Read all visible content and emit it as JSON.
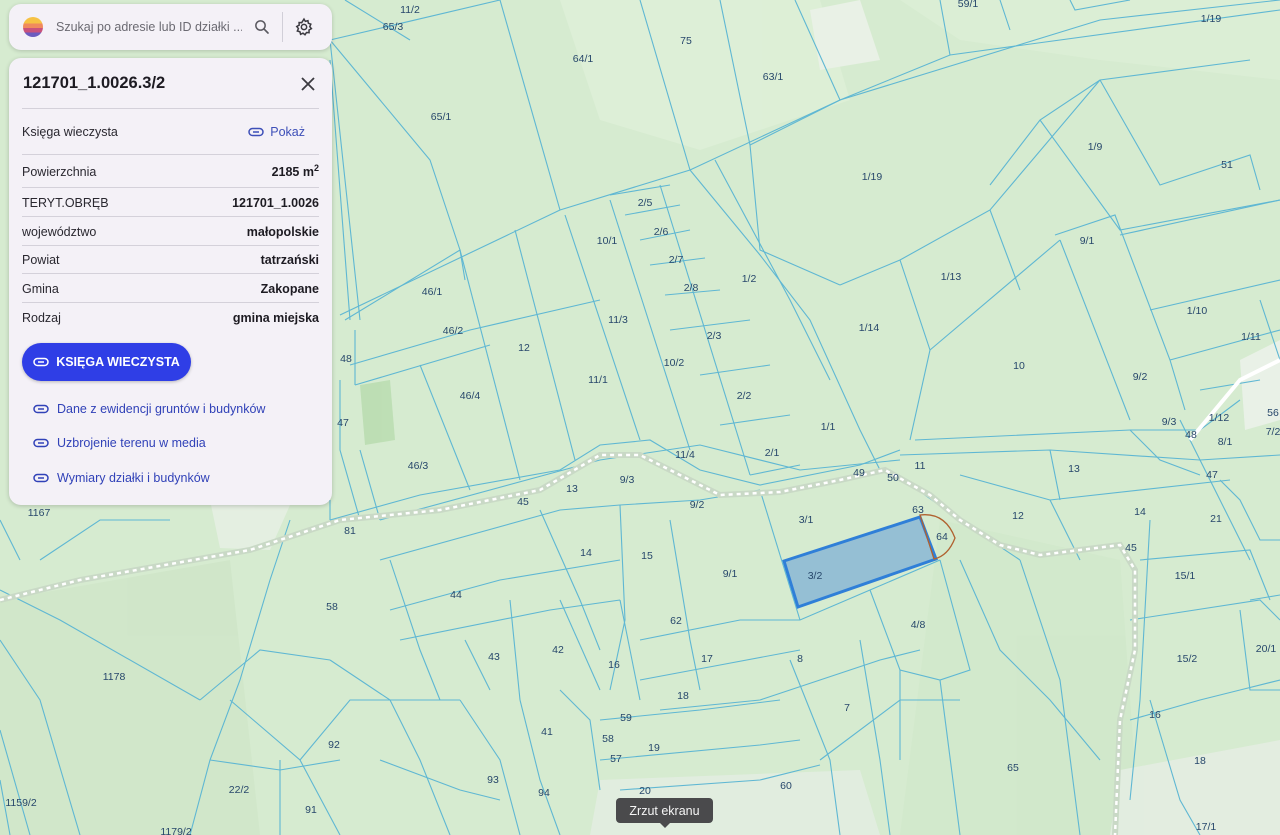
{
  "search": {
    "placeholder": "Szukaj po adresie lub ID działki ..."
  },
  "panel": {
    "title": "121701_1.0026.3/2",
    "land_register_label": "Księga wieczysta",
    "show_link": "Pokaż",
    "rows": [
      {
        "label": "Powierzchnia",
        "value": "2185 m",
        "sup": "2"
      },
      {
        "label": "TERYT.OBRĘB",
        "value": "121701_1.0026"
      },
      {
        "label": "województwo",
        "value": "małopolskie"
      },
      {
        "label": "Powiat",
        "value": "tatrzański"
      },
      {
        "label": "Gmina",
        "value": "Zakopane"
      },
      {
        "label": "Rodzaj",
        "value": "gmina miejska"
      }
    ],
    "primary_button": "KSIĘGA WIECZYSTA",
    "links": [
      "Dane z ewidencji gruntów i budynków",
      "Uzbrojenie terenu w media",
      "Wymiary działki i budynków"
    ]
  },
  "tooltip": "Zrzut ekranu",
  "colors": {
    "map_background": "#d6ebd0",
    "parcel_line": "#5fb7d3",
    "selected_fill": "#7fb0d6",
    "selected_stroke": "#2f7fd8",
    "accent": "#2f3ee6",
    "trail": "#ffffff"
  },
  "map": {
    "parcel_labels": [
      "11/2",
      "59/1",
      "1/19",
      "65/3",
      "75",
      "64/1",
      "63/1",
      "65/1",
      "1/9",
      "51",
      "1/19",
      "2/5",
      "10/1",
      "2/6",
      "2/7",
      "1/2",
      "1/13",
      "9/1",
      "46/1",
      "2/8",
      "11/3",
      "1/10",
      "46/2",
      "12",
      "1/14",
      "1/11",
      "48",
      "2/3",
      "10/2",
      "10",
      "9/2",
      "11/1",
      "46/4",
      "47",
      "2/2",
      "1/12",
      "56",
      "9/3",
      "48",
      "7/2",
      "1/1",
      "8/1",
      "46/3",
      "11/4",
      "2/1",
      "11",
      "13",
      "47",
      "9/3",
      "49",
      "50",
      "13",
      "45",
      "9/2",
      "3/1",
      "63",
      "12",
      "14",
      "21",
      "1167",
      "81",
      "15",
      "64",
      "45",
      "3/2",
      "15/1",
      "9/1",
      "14",
      "58",
      "44",
      "62",
      "4/8",
      "20/1",
      "17",
      "8",
      "15/2",
      "43",
      "42",
      "16",
      "1178",
      "18",
      "7",
      "16",
      "41",
      "59",
      "92",
      "58",
      "19",
      "18",
      "22/2",
      "57",
      "65",
      "93",
      "94",
      "60",
      "20",
      "1159/2",
      "91",
      "17/1",
      "1179/2"
    ],
    "selected_parcel": "3/2"
  }
}
